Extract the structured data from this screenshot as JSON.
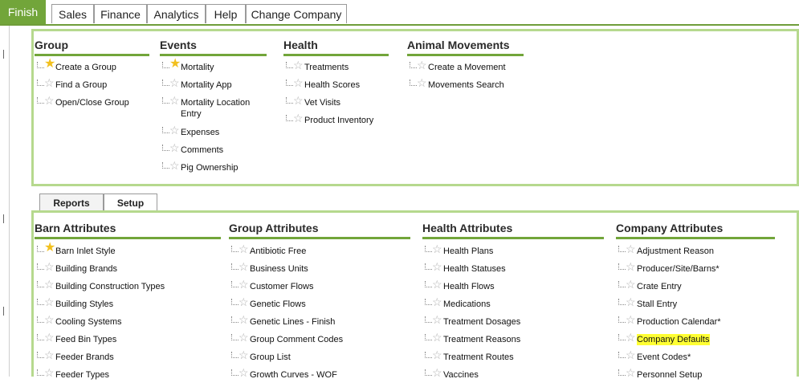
{
  "top_tabs": [
    "Finish",
    "Sales",
    "Finance",
    "Analytics",
    "Help",
    "Change Company"
  ],
  "top_panel": {
    "columns": [
      {
        "heading": "Group",
        "items": [
          {
            "label": "Create a Group",
            "fav": true
          },
          {
            "label": "Find a Group",
            "fav": false
          },
          {
            "label": "Open/Close Group",
            "fav": false
          }
        ]
      },
      {
        "heading": "Events",
        "items": [
          {
            "label": "Mortality",
            "fav": true
          },
          {
            "label": "Mortality App",
            "fav": false
          },
          {
            "label": "Mortality Location Entry",
            "fav": false
          },
          {
            "label": "Expenses",
            "fav": false
          },
          {
            "label": "Comments",
            "fav": false
          },
          {
            "label": "Pig Ownership",
            "fav": false
          }
        ]
      },
      {
        "heading": "Health",
        "items": [
          {
            "label": "Treatments",
            "fav": false
          },
          {
            "label": "Health Scores",
            "fav": false
          },
          {
            "label": "Vet Visits",
            "fav": false
          },
          {
            "label": "Product Inventory",
            "fav": false
          }
        ]
      },
      {
        "heading": "Animal Movements",
        "items": [
          {
            "label": "Create a Movement",
            "fav": false
          },
          {
            "label": "Movements Search",
            "fav": false
          }
        ]
      }
    ]
  },
  "sub_tabs": [
    "Reports",
    "Setup"
  ],
  "bottom_panel": {
    "columns": [
      {
        "heading": "Barn Attributes",
        "items": [
          {
            "label": "Barn Inlet Style",
            "fav": true
          },
          {
            "label": "Building Brands",
            "fav": false
          },
          {
            "label": "Building Construction Types",
            "fav": false
          },
          {
            "label": "Building Styles",
            "fav": false
          },
          {
            "label": "Cooling Systems",
            "fav": false
          },
          {
            "label": "Feed Bin Types",
            "fav": false
          },
          {
            "label": "Feeder Brands",
            "fav": false
          },
          {
            "label": "Feeder Types",
            "fav": false
          }
        ]
      },
      {
        "heading": "Group Attributes",
        "items": [
          {
            "label": "Antibiotic Free",
            "fav": false
          },
          {
            "label": "Business Units",
            "fav": false
          },
          {
            "label": "Customer Flows",
            "fav": false
          },
          {
            "label": "Genetic Flows",
            "fav": false
          },
          {
            "label": "Genetic Lines - Finish",
            "fav": false
          },
          {
            "label": "Group Comment Codes",
            "fav": false
          },
          {
            "label": "Group List",
            "fav": false
          },
          {
            "label": "Growth Curves - WOF",
            "fav": false
          }
        ]
      },
      {
        "heading": "Health Attributes",
        "items": [
          {
            "label": "Health Plans",
            "fav": false
          },
          {
            "label": "Health Statuses",
            "fav": false
          },
          {
            "label": "Health Flows",
            "fav": false
          },
          {
            "label": "Medications",
            "fav": false
          },
          {
            "label": "Treatment Dosages",
            "fav": false
          },
          {
            "label": "Treatment Reasons",
            "fav": false
          },
          {
            "label": "Treatment Routes",
            "fav": false
          },
          {
            "label": "Vaccines",
            "fav": false
          }
        ]
      },
      {
        "heading": "Company Attributes",
        "items": [
          {
            "label": "Adjustment Reason",
            "fav": false
          },
          {
            "label": "Producer/Site/Barns*",
            "fav": false
          },
          {
            "label": "Crate Entry",
            "fav": false
          },
          {
            "label": "Stall Entry",
            "fav": false
          },
          {
            "label": "Production Calendar*",
            "fav": false
          },
          {
            "label": "Company Defaults",
            "fav": false,
            "highlight": true
          },
          {
            "label": "Event Codes*",
            "fav": false
          },
          {
            "label": "Personnel Setup",
            "fav": false
          }
        ]
      }
    ]
  },
  "colors": {
    "accent": "#72a53a",
    "panel_border": "#b6d98e",
    "star_fav": "#f2c01f",
    "star_empty": "#b0b0b0",
    "highlight": "#ffff33"
  },
  "icons": {
    "fav_star": "star-filled-icon",
    "empty_star": "star-outline-icon"
  }
}
